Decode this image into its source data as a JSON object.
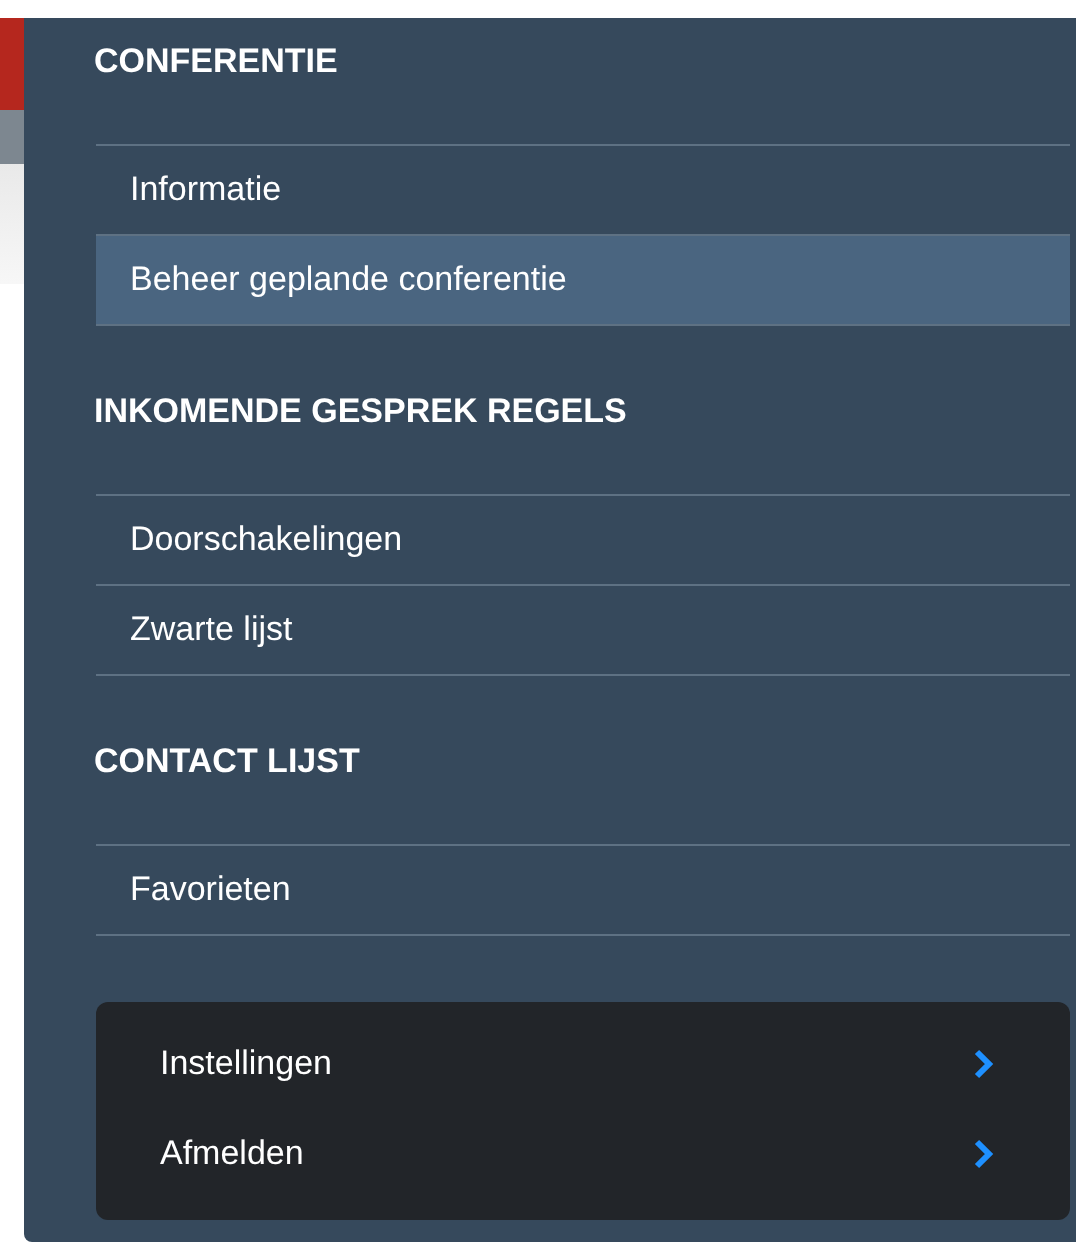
{
  "sections": [
    {
      "heading": "CONFERENTIE",
      "items": [
        {
          "label": "Informatie",
          "selected": false
        },
        {
          "label": "Beheer geplande conferentie",
          "selected": true
        }
      ]
    },
    {
      "heading": "INKOMENDE GESPREK REGELS",
      "items": [
        {
          "label": "Doorschakelingen",
          "selected": false
        },
        {
          "label": "Zwarte lijst",
          "selected": false
        }
      ]
    },
    {
      "heading": "CONTACT LIJST",
      "items": [
        {
          "label": "Favorieten",
          "selected": false
        }
      ]
    }
  ],
  "footer_menu": [
    {
      "label": "Instellingen"
    },
    {
      "label": "Afmelden"
    }
  ]
}
